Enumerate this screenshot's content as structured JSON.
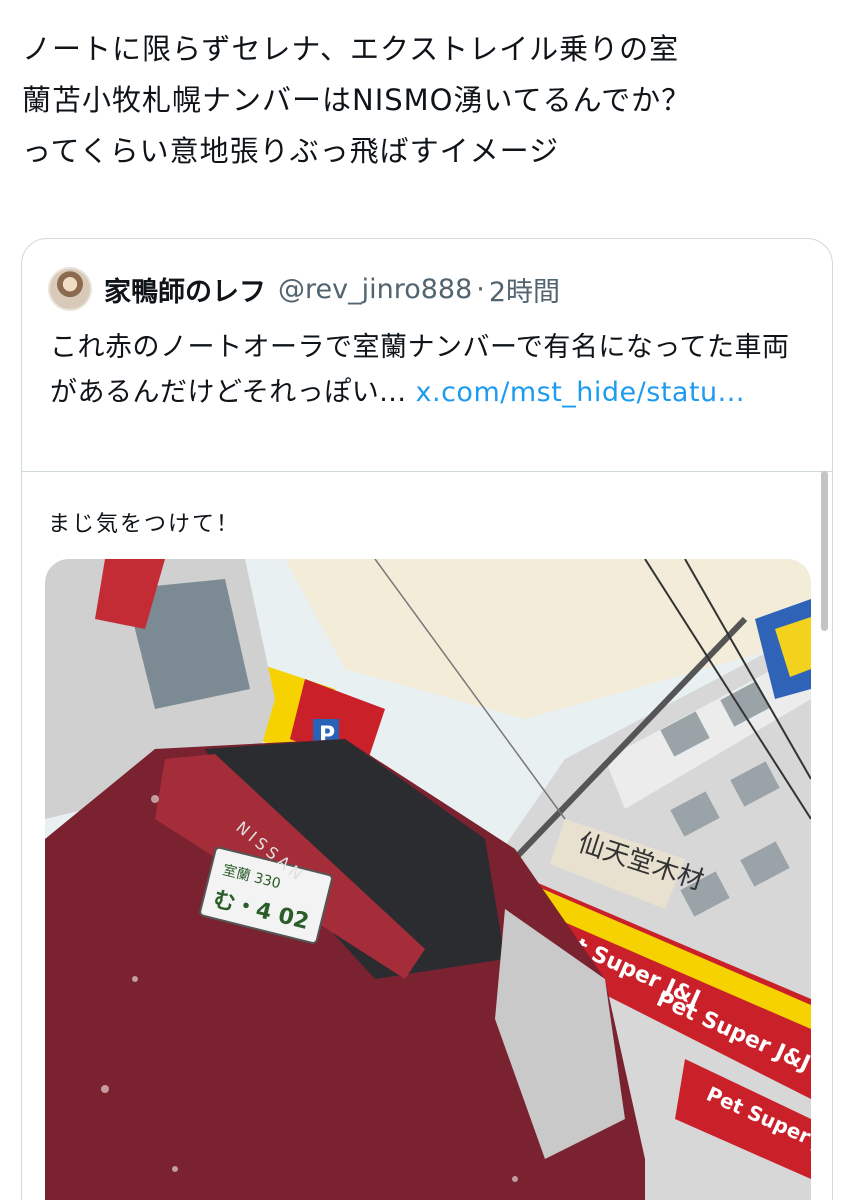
{
  "tweet": {
    "text": "ノートに限らずセレナ、エクストレイル乗りの室\n蘭苫小牧札幌ナンバーはNISMO湧いてるんでか？\nってくらい意地張りぶっ飛ばすイメージ"
  },
  "quote": {
    "display_name": "家鴨師のレフ",
    "handle": "@rev_jinro888",
    "separator": "·",
    "time": "2時間",
    "text": "これ赤のノートオーラで室蘭ナンバーで有名になってた車両があるんだけどそれっぽい... ",
    "link_text": "x.com/mst_hide/statu..."
  },
  "inner_tweet": {
    "text": "まじ気をつけて！"
  },
  "photo": {
    "plate_text_top": "室蘭 330",
    "plate_text_bottom": "む・4 02",
    "car_brand": "NISSAN",
    "sign_pet": "Pet Super J&J",
    "sign_parking": "P",
    "sign_shop": "仙天堂木材",
    "colors": {
      "car": "#7a2230",
      "sky": "#e6eef1",
      "building": "#d9d9d9"
    }
  },
  "icons": {
    "avatar": "user-avatar-icon"
  }
}
